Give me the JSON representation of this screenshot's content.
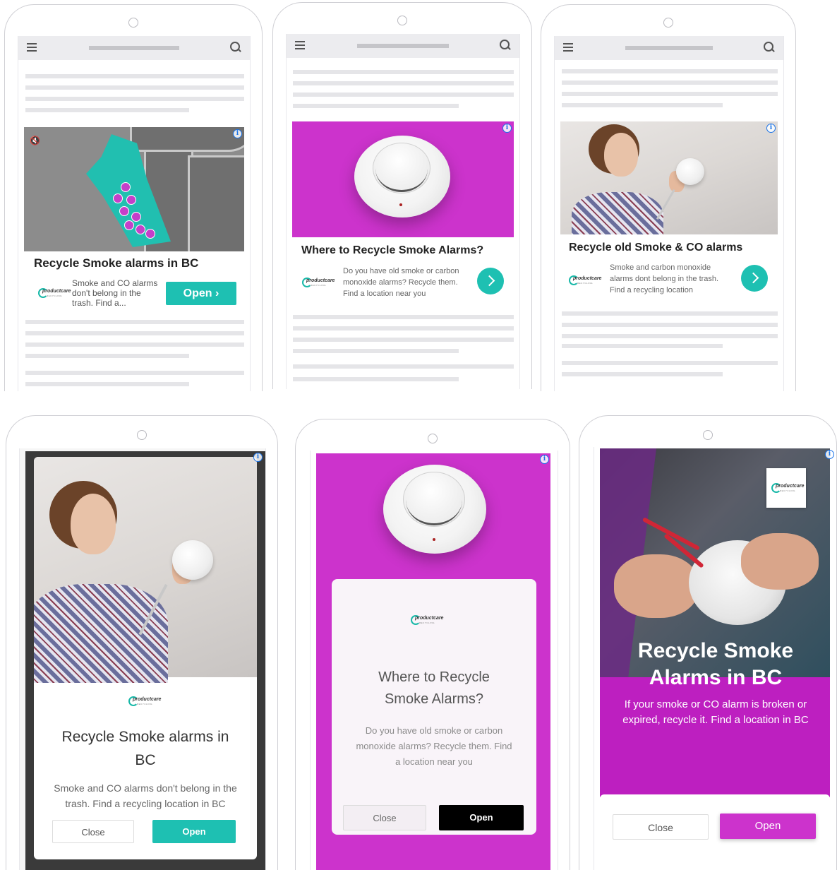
{
  "colors": {
    "teal": "#1ec0b2",
    "magenta": "#cc33cc",
    "dark_magenta": "#bd1fc0",
    "black_button": "#000000"
  },
  "icons": [
    "hamburger-menu-icon",
    "search-icon",
    "ad-info-icon",
    "mute-icon",
    "chevron-right-icon",
    "productcare-logo"
  ],
  "brand": {
    "logo_text": "productcare",
    "logo_sub": "RECYCLING"
  },
  "ads": {
    "a1": {
      "mute_glyph": "🔇",
      "title": "Recycle Smoke alarms in BC",
      "desc": "Smoke and CO alarms don't belong in the trash. Find a...",
      "cta": "Open ›"
    },
    "a2": {
      "title": "Where to Recycle Smoke Alarms?",
      "desc": "Do you have old smoke or carbon monoxide alarms? Recycle them. Find a location near you"
    },
    "a3": {
      "title": "Recycle old Smoke & CO alarms",
      "desc": "Smoke and carbon monoxide alarms dont belong in the trash. Find a recycling location"
    },
    "b1": {
      "title": "Recycle Smoke alarms in BC",
      "desc": "Smoke and CO alarms don't belong in the trash. Find a recycling location in BC",
      "close": "Close",
      "open": "Open"
    },
    "b2": {
      "title": "Where to Recycle Smoke Alarms?",
      "desc": "Do you have old smoke or carbon monoxide alarms? Recycle them. Find a location near you",
      "close": "Close",
      "open": "Open"
    },
    "b3": {
      "title": "Recycle Smoke Alarms in BC",
      "desc": "If your smoke or CO alarm is broken or expired, recycle it. Find a location in BC",
      "close": "Close",
      "open": "Open"
    }
  }
}
